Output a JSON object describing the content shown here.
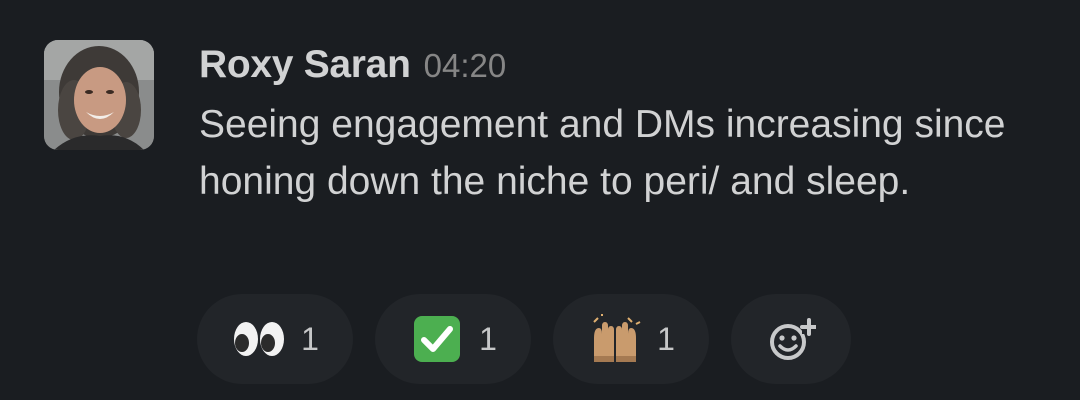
{
  "message": {
    "author": "Roxy Saran",
    "timestamp": "04:20",
    "text": "Seeing engagement and DMs increasing since honing down the niche to peri/ and sleep."
  },
  "reactions": [
    {
      "emoji": "eyes-emoji",
      "count": "1"
    },
    {
      "emoji": "white-check-mark-emoji",
      "count": "1"
    },
    {
      "emoji": "raised-hands-emoji",
      "count": "1"
    }
  ],
  "add_reaction": {
    "icon": "add-reaction-icon"
  },
  "colors": {
    "background": "#1a1d21",
    "text": "#d1d2d3",
    "timestamp": "#868686",
    "reaction_bg": "#222529",
    "check_green": "#4caf50"
  }
}
